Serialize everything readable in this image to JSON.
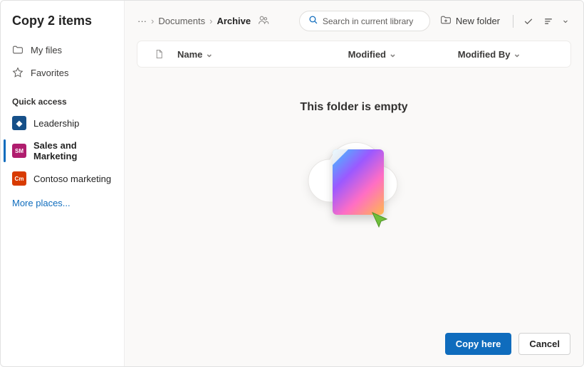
{
  "title": "Copy 2 items",
  "nav": {
    "my_files": "My files",
    "favorites": "Favorites"
  },
  "quick_access": {
    "label": "Quick access",
    "items": [
      {
        "label": "Leadership",
        "color": "#165089",
        "active": false,
        "glyph": "◆"
      },
      {
        "label": "Sales and Marketing",
        "color": "#b01d6e",
        "active": true,
        "glyph": "SM"
      },
      {
        "label": "Contoso marketing",
        "color": "#d83b01",
        "active": false,
        "glyph": "Cm"
      }
    ],
    "more": "More places..."
  },
  "breadcrumbs": {
    "ellipsis": "···",
    "parent": "Documents",
    "current": "Archive"
  },
  "search": {
    "placeholder": "Search in current library"
  },
  "toolbar": {
    "new_folder": "New folder"
  },
  "columns": {
    "name": "Name",
    "modified": "Modified",
    "modified_by": "Modified By"
  },
  "empty": {
    "title": "This folder is empty"
  },
  "footer": {
    "primary": "Copy here",
    "cancel": "Cancel"
  }
}
